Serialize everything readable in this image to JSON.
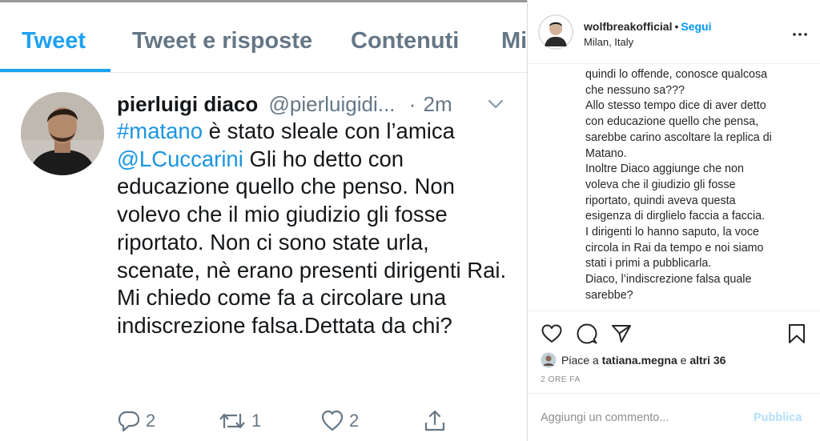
{
  "twitter": {
    "tabs": [
      {
        "label": "Tweet",
        "active": true
      },
      {
        "label": "Tweet e risposte",
        "active": false
      },
      {
        "label": "Contenuti",
        "active": false
      },
      {
        "label": "Mi",
        "active": false
      }
    ],
    "tweet": {
      "author_name": "pierluigi diaco",
      "author_handle": "@pierluigidi...",
      "separator": "·",
      "time": "2m",
      "text_parts": [
        {
          "type": "link",
          "text": "#matano"
        },
        {
          "type": "text",
          "text": " è stato sleale con l’amica "
        },
        {
          "type": "link",
          "text": "@LCuccarini"
        },
        {
          "type": "text",
          "text": " Gli ho detto con educazione quello che penso. Non volevo che il mio giudizio gli fosse riportato. Non ci sono state urla, scenate, nè erano presenti dirigenti Rai. Mi chiedo come fa a circolare una indiscrezione falsa.Dettata da chi?"
        }
      ],
      "replies": "2",
      "retweets": "1",
      "likes": "2"
    },
    "colors": {
      "accent": "#1da1f2",
      "link": "#1b95e0",
      "secondary": "#657786",
      "text": "#14171a"
    },
    "icons": [
      "chevron-down-icon",
      "reply-icon",
      "retweet-icon",
      "like-icon",
      "share-icon"
    ]
  },
  "instagram": {
    "username": "wolfbreakofficial",
    "separator": "•",
    "follow_label": "Segui",
    "location": "Milan, Italy",
    "caption_lines": [
      "quindi lo offende, conosce qualcosa",
      "che nessuno sa???",
      "Allo stesso tempo dice di aver detto",
      "con educazione quello che pensa,",
      "sarebbe carino ascoltare la replica di",
      "Matano.",
      "Inoltre Diaco aggiunge che non",
      "voleva che il giudizio gli fosse",
      "riportato, quindi aveva questa",
      "esigenza di dirglielo faccia a faccia.",
      "I dirigenti lo hanno saputo, la voce",
      "circola in Rai da tempo e noi siamo",
      "stati i primi a pubblicarla.",
      "Diaco, l’indiscrezione falsa quale",
      "sarebbe?"
    ],
    "likes": {
      "prefix": "Piace a",
      "user": "tatiana.megna",
      "connector": "e",
      "others": "altri 36"
    },
    "time": "2 ORE FA",
    "comment_placeholder": "Aggiungi un commento...",
    "publish_label": "Pubblica",
    "colors": {
      "follow": "#0095f6",
      "publish_disabled": "#b2dffc",
      "muted": "#8e8e8e",
      "text": "#262626"
    },
    "icons": [
      "more-icon",
      "heart-icon",
      "comment-icon",
      "share-icon",
      "bookmark-icon"
    ]
  }
}
